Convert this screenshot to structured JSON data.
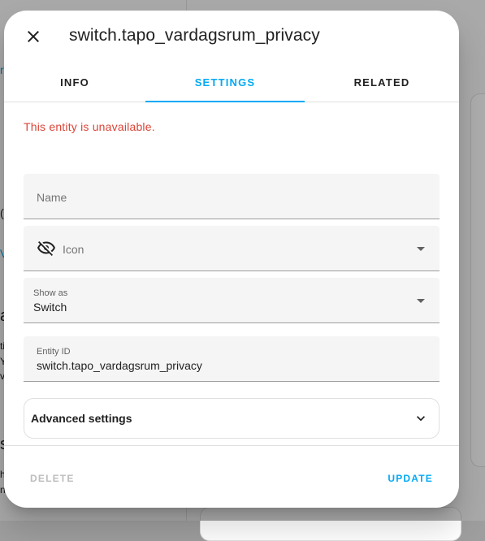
{
  "dialog": {
    "title": "switch.tapo_vardagsrum_privacy",
    "tabs": [
      {
        "label": "INFO",
        "active": false
      },
      {
        "label": "SETTINGS",
        "active": true
      },
      {
        "label": "RELATED",
        "active": false
      }
    ],
    "error_message": "This entity is unavailable.",
    "fields": {
      "name": {
        "placeholder": "Name",
        "value": ""
      },
      "icon": {
        "placeholder": "Icon",
        "icon": "eye-off-icon"
      },
      "show_as": {
        "label": "Show as",
        "value": "Switch"
      },
      "entity_id": {
        "label": "Entity ID",
        "value": "switch.tapo_vardagsrum_privacy"
      }
    },
    "advanced_settings_label": "Advanced settings",
    "footer": {
      "delete_label": "DELETE",
      "update_label": "UPDATE"
    }
  },
  "colors": {
    "accent": "#03a9f4",
    "error": "#db4437",
    "disabled": "#bdbdbd"
  }
}
